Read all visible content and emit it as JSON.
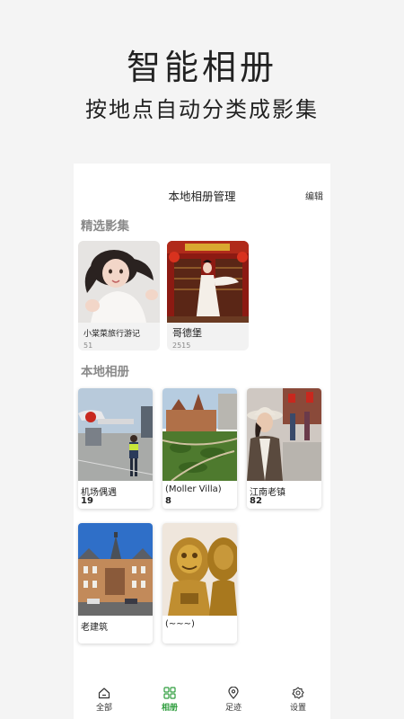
{
  "hero": {
    "title": "智能相册",
    "subtitle": "按地点自动分类成影集"
  },
  "header": {
    "title": "本地相册管理",
    "edit_label": "编辑"
  },
  "featured": {
    "section_title": "精选影集",
    "items": [
      {
        "name": "小棠菜旅行游记",
        "count": "51"
      },
      {
        "name": "哥德堡",
        "count": "2515"
      }
    ]
  },
  "local": {
    "section_title": "本地相册",
    "items": [
      {
        "name": "机场偶遇",
        "count": "19"
      },
      {
        "name": "(Moller Villa)",
        "count": "8"
      },
      {
        "name": "江南老镇",
        "count": "82"
      },
      {
        "name": "老建筑",
        "count": ""
      },
      {
        "name": "(~~~)",
        "count": ""
      }
    ]
  },
  "tabbar": {
    "active_color": "#2e9d3d",
    "tabs": [
      {
        "label": "全部",
        "icon": "home-icon"
      },
      {
        "label": "相册",
        "icon": "grid-icon"
      },
      {
        "label": "足迹",
        "icon": "location-pin-icon"
      },
      {
        "label": "设置",
        "icon": "gear-icon"
      }
    ]
  }
}
